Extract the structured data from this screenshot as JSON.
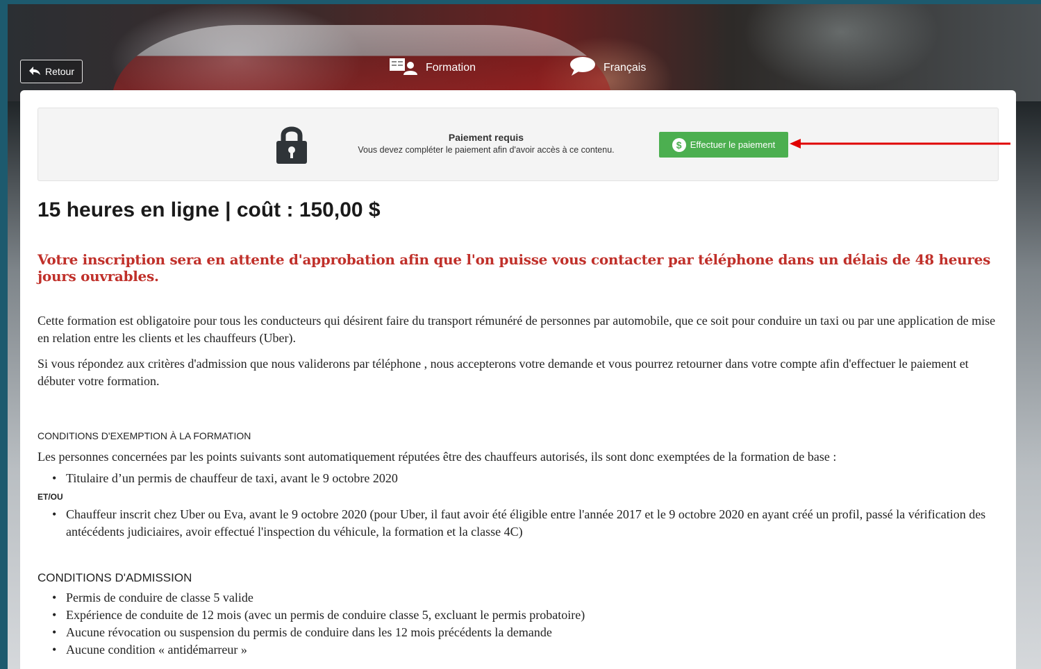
{
  "header": {
    "back_label": "Retour",
    "back_icon": "arrow-left-icon",
    "category_label": "Formation",
    "category_icon": "course-icon",
    "language_label": "Français",
    "language_icon": "speech-bubble-icon"
  },
  "notice": {
    "lock_icon": "lock-icon",
    "title": "Paiement requis",
    "message": "Vous devez compléter le paiement afin d'avoir accès à ce contenu.",
    "pay_label": "Effectuer le paiement",
    "pay_icon": "dollar-circle-icon",
    "pay_color": "#4caf50",
    "annotation_arrow_color": "#e00000"
  },
  "course": {
    "title": "15 heures en ligne | coût : 150,00 $",
    "warning": "Votre inscription sera en attente d'approbation afin que l'on puisse vous contacter par téléphone dans un délais de 48 heures jours ouvrables.",
    "warning_color": "#c0302a",
    "intro_1": "Cette formation est obligatoire pour tous les conducteurs qui désirent faire du transport rémunéré de personnes par automobile, que ce soit pour conduire un taxi ou par une application de mise en relation entre les clients et les chauffeurs (Uber).",
    "intro_2": "Si vous répondez aux critères d'admission que nous validerons par téléphone , nous accepterons votre demande et vous pourrez retourner dans votre compte  afin d'effectuer le paiement et débuter votre formation.",
    "exemption_heading": "CONDITIONS D'EXEMPTION À LA FORMATION",
    "exemption_intro": "Les personnes concernées par les points suivants sont automatiquement réputées être des chauffeurs autorisés, ils sont donc exemptées de la formation de base :",
    "exemption_item_1": "Titulaire d’un permis de chauffeur de taxi, avant le 9 octobre 2020",
    "connector": "ET/OU",
    "exemption_item_2": "Chauffeur inscrit chez Uber ou Eva, avant le 9 octobre 2020 (pour Uber, il faut avoir été éligible entre l'année 2017 et le 9 octobre 2020 en ayant créé un profil, passé la vérification des antécédents judiciaires, avoir effectué l'inspection du véhicule, la formation et la classe 4C)",
    "admission_heading": "CONDITIONS D'ADMISSION",
    "admission_items": [
      "Permis de conduire de classe 5 valide",
      "Expérience de conduite de 12 mois (avec un permis de conduire classe 5, excluant le permis probatoire)",
      "Aucune révocation ou suspension du permis de conduire dans les 12 mois précédents la demande",
      "Aucune condition « antidémarreur »"
    ]
  }
}
